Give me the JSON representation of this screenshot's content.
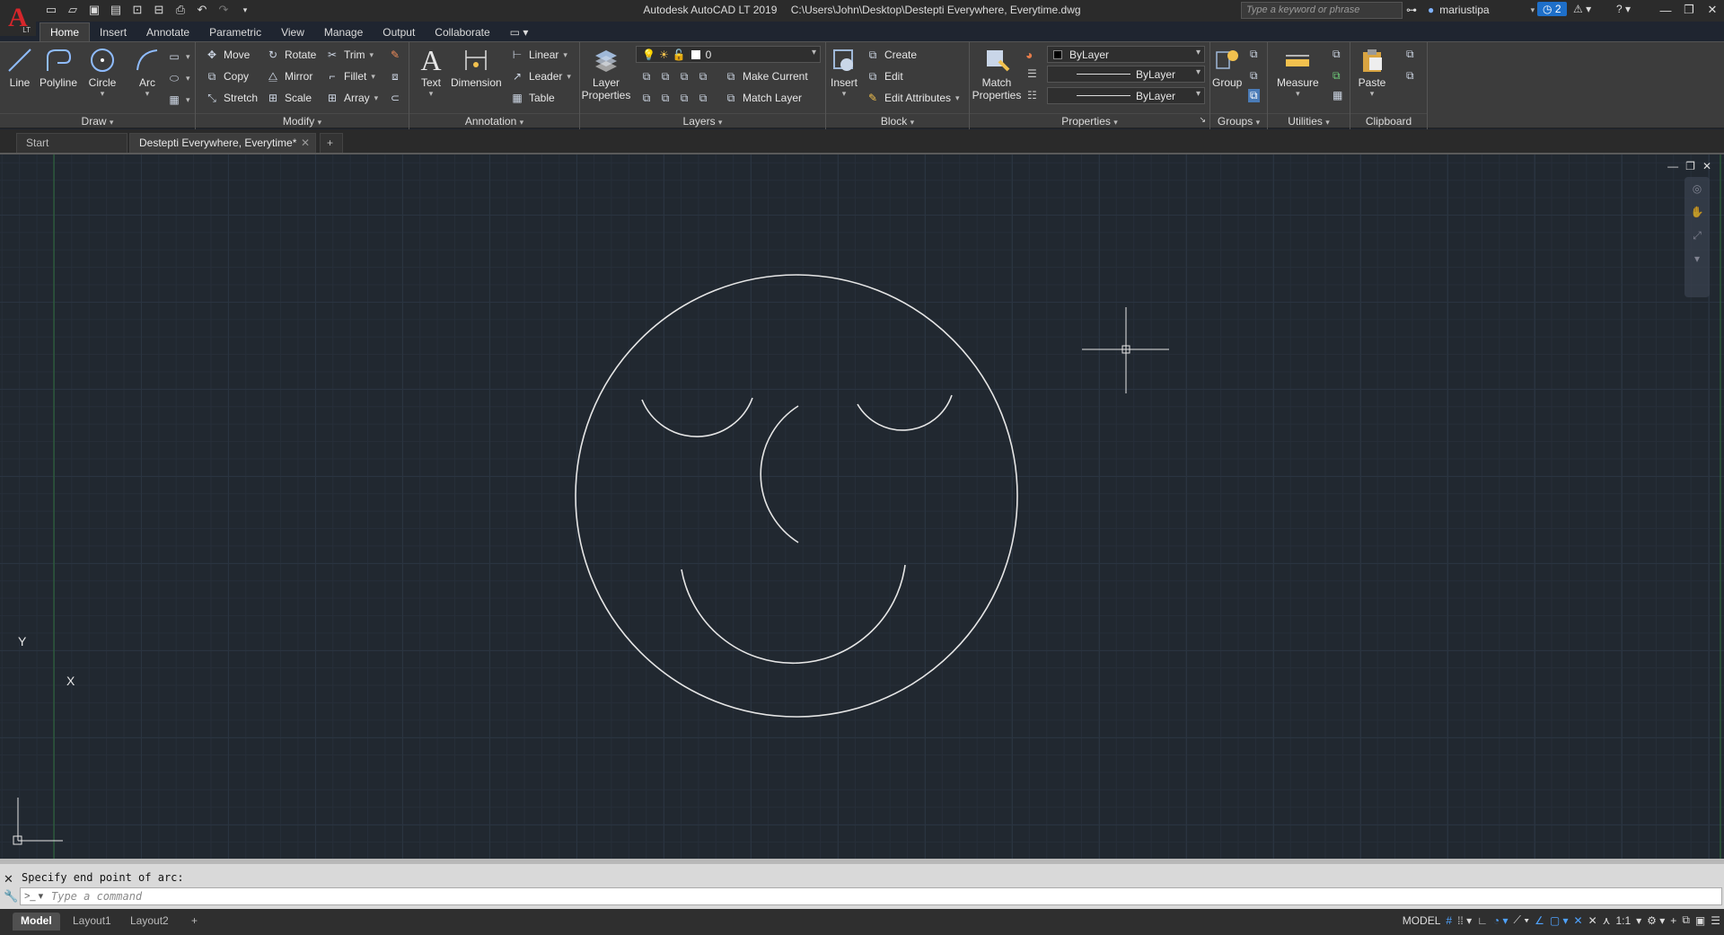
{
  "window": {
    "app_title": "Autodesk AutoCAD LT 2019",
    "file_path": "C:\\Users\\John\\Desktop\\Destepti Everywhere, Everytime.dwg",
    "search_placeholder": "Type a keyword or phrase",
    "user": "mariustipa",
    "notifications": "2",
    "app_letter": "A",
    "app_sub": "LT"
  },
  "ribbon_tabs": [
    "Home",
    "Insert",
    "Annotate",
    "Parametric",
    "View",
    "Manage",
    "Output",
    "Collaborate"
  ],
  "draw": {
    "label": "Draw",
    "line": "Line",
    "polyline": "Polyline",
    "circle": "Circle",
    "arc": "Arc"
  },
  "modify": {
    "label": "Modify",
    "move": "Move",
    "rotate": "Rotate",
    "trim": "Trim",
    "copy": "Copy",
    "mirror": "Mirror",
    "fillet": "Fillet",
    "stretch": "Stretch",
    "scale": "Scale",
    "array": "Array"
  },
  "annotation": {
    "label": "Annotation",
    "text": "Text",
    "dimension": "Dimension",
    "linear": "Linear",
    "leader": "Leader",
    "table": "Table"
  },
  "layers": {
    "label": "Layers",
    "properties": "Layer Properties",
    "current_layer": "0",
    "make_current": "Make Current",
    "match_layer": "Match Layer"
  },
  "block": {
    "label": "Block",
    "insert": "Insert",
    "create": "Create",
    "edit": "Edit",
    "edit_attributes": "Edit Attributes"
  },
  "properties": {
    "label": "Properties",
    "match": "Match Properties",
    "color": "ByLayer",
    "linetype": "ByLayer",
    "lineweight": "ByLayer"
  },
  "groups": {
    "label": "Groups",
    "group": "Group"
  },
  "utilities": {
    "label": "Utilities",
    "measure": "Measure"
  },
  "clipboard": {
    "label": "Clipboard",
    "paste": "Paste"
  },
  "file_tabs": [
    "Start",
    "Destepti Everywhere, Everytime*"
  ],
  "command": {
    "history": "Specify end point of arc:",
    "placeholder": "Type a command"
  },
  "layout_tabs": [
    "Model",
    "Layout1",
    "Layout2"
  ],
  "status": {
    "model": "MODEL",
    "scale": "1:1"
  },
  "ucs": {
    "x": "X",
    "y": "Y"
  }
}
